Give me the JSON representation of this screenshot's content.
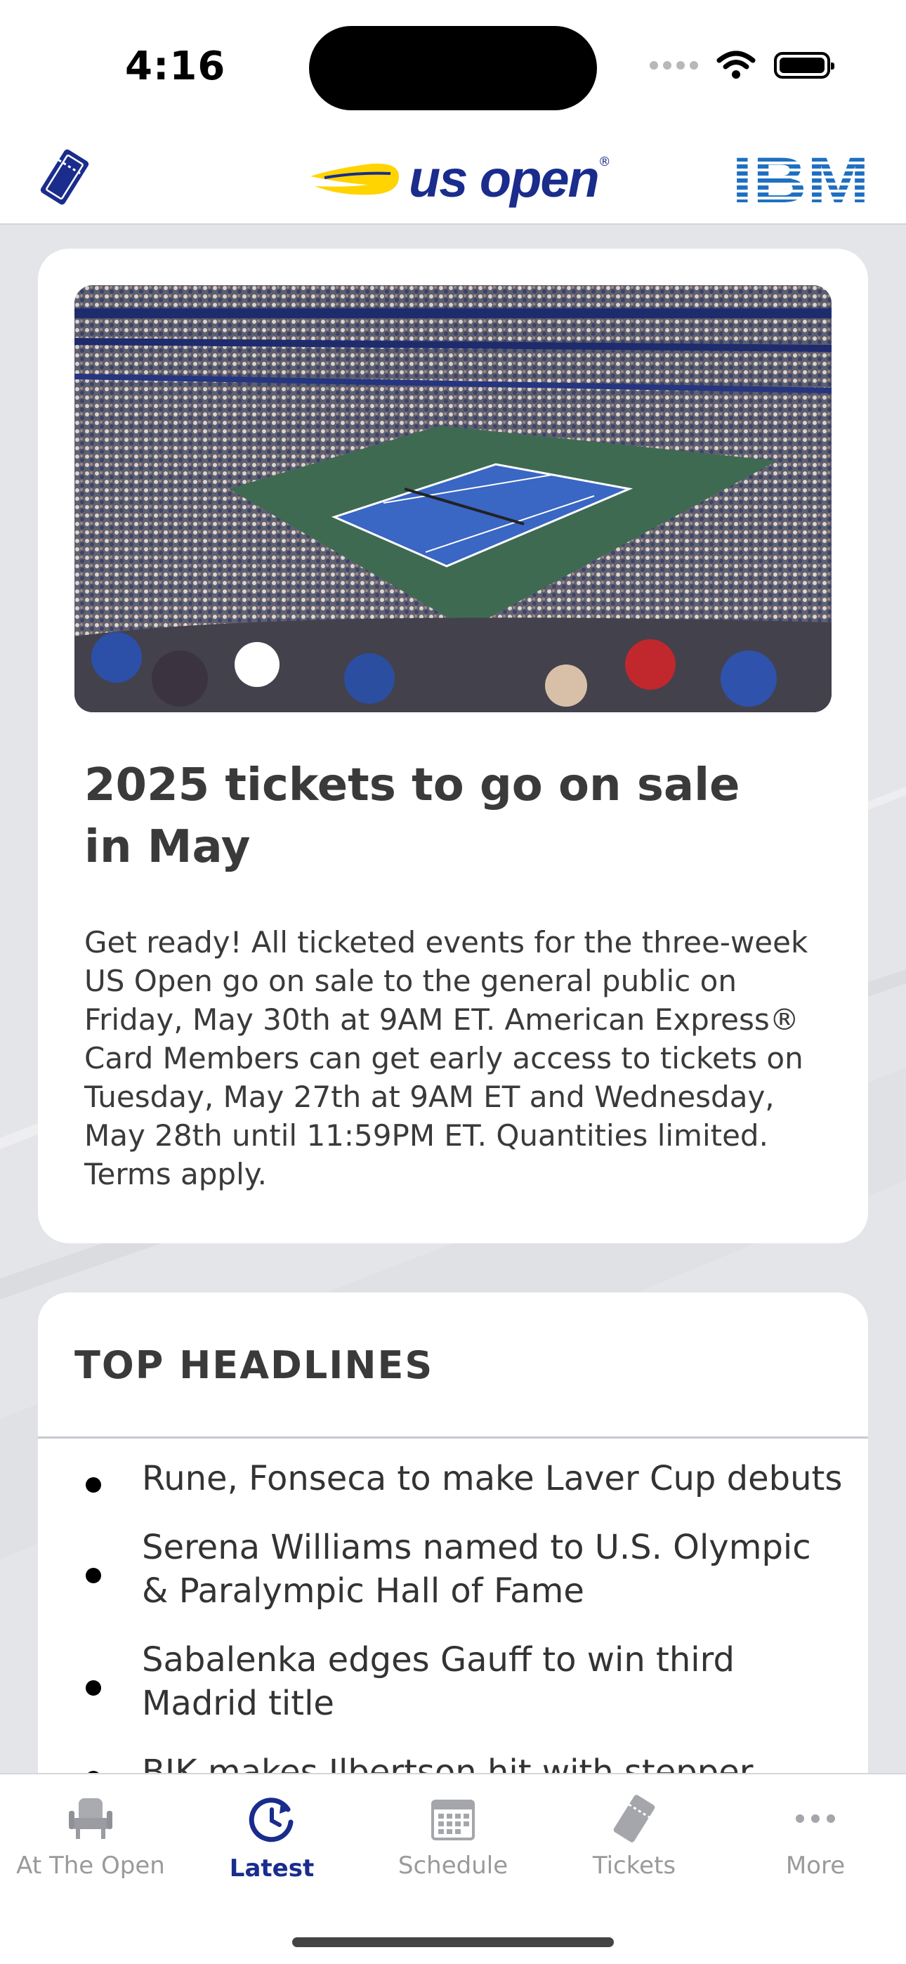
{
  "status_bar": {
    "time": "4:16"
  },
  "header": {
    "brand": "us open",
    "partner": "IBM"
  },
  "news_card": {
    "title": "2025 tickets to go on sale in May",
    "body": "Get ready! All ticketed events for the three-week US Open go on sale to the general public on Friday, May 30th at 9AM ET. American Express® Card Members can get early access to tickets on Tuesday, May 27th at 9AM ET and Wednesday, May 28th until 11:59PM ET. Quantities limited. Terms apply."
  },
  "headlines": {
    "title": "TOP HEADLINES",
    "items": [
      "Rune, Fonseca to make Laver Cup debuts",
      "Serena Williams named to U.S. Olympic & Paralympic Hall of Fame",
      "Sabalenka edges Gauff to win third Madrid title",
      "BJK makes Ilbertson hit with stepper"
    ]
  },
  "tab_bar": {
    "items": [
      {
        "label": "At The Open",
        "icon": "seat-icon"
      },
      {
        "label": "Latest",
        "icon": "clock-refresh-icon"
      },
      {
        "label": "Schedule",
        "icon": "calendar-icon"
      },
      {
        "label": "Tickets",
        "icon": "ticket-icon"
      },
      {
        "label": "More",
        "icon": "more-icon"
      }
    ],
    "active": "Latest"
  },
  "colors": {
    "brand_blue": "#1a2c8c",
    "brand_yellow": "#ffd400",
    "ibm_blue": "#1f70c1"
  }
}
